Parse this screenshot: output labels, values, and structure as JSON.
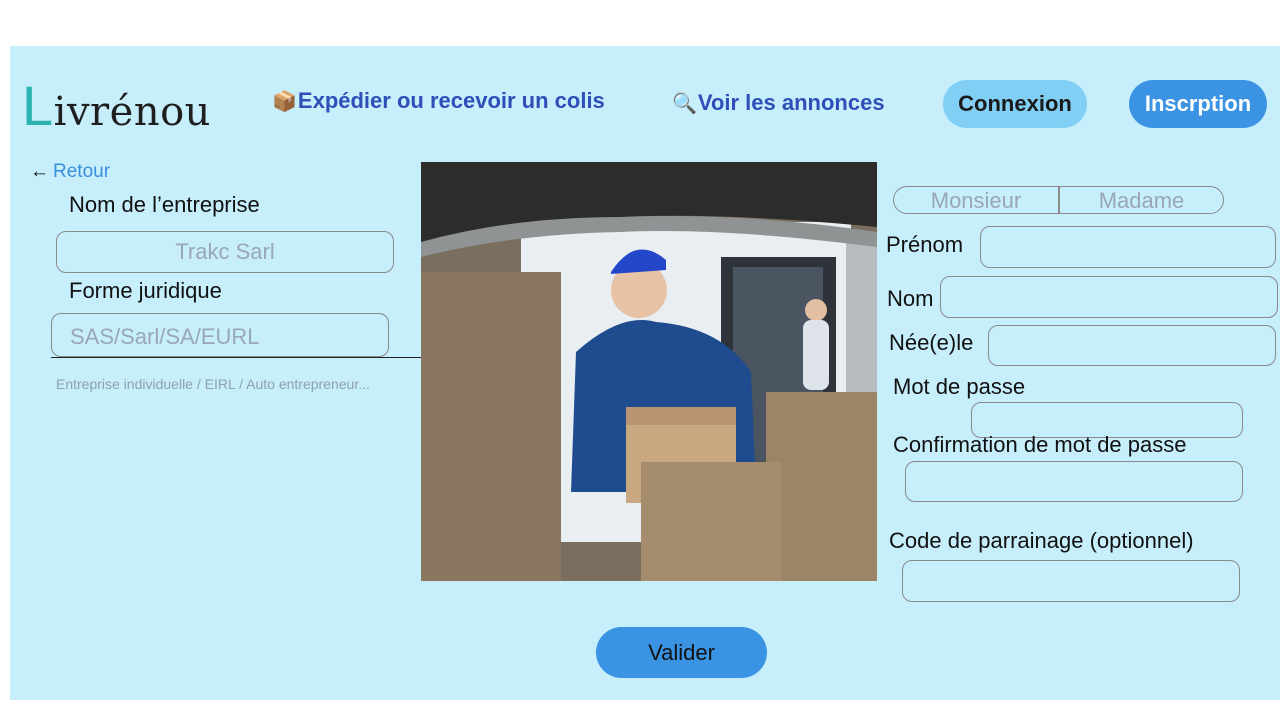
{
  "header": {
    "logo_first": "L",
    "logo_rest": "ivrénou",
    "nav_expedier_icon": "📦",
    "nav_expedier_label": "Expédier ou recevoir un colis",
    "nav_annonces_icon": "🔍",
    "nav_annonces_label": "Voir les annonces",
    "connexion_label": "Connexion",
    "inscription_label": "Inscrption"
  },
  "left_form": {
    "back_arrow": "←",
    "back_label": "Retour",
    "company_name_label": "Nom de l’entreprise",
    "company_name_placeholder": "Trakc Sarl",
    "legal_form_label": "Forme juridique",
    "legal_form_placeholder": "SAS/Sarl/SA/EURL",
    "legal_form_hint": "Entreprise individuelle / EIRL / Auto entrepreneur..."
  },
  "right_form": {
    "civility_options": [
      "Monsieur",
      "Madame"
    ],
    "prenom_label": "Prénom",
    "nom_label": "Nom",
    "naissance_label": "Née(e)le",
    "password_label": "Mot de passe",
    "password_confirm_label": "Confirmation de mot de passe",
    "referral_label": "Code de parrainage (optionnel)"
  },
  "submit_label": "Valider",
  "colors": {
    "background": "#c6eefb",
    "logo_accent": "#2bb3b0",
    "nav_link": "#2f4fb8",
    "connexion_button": "#81cff5",
    "primary_button": "#3b93e4"
  }
}
